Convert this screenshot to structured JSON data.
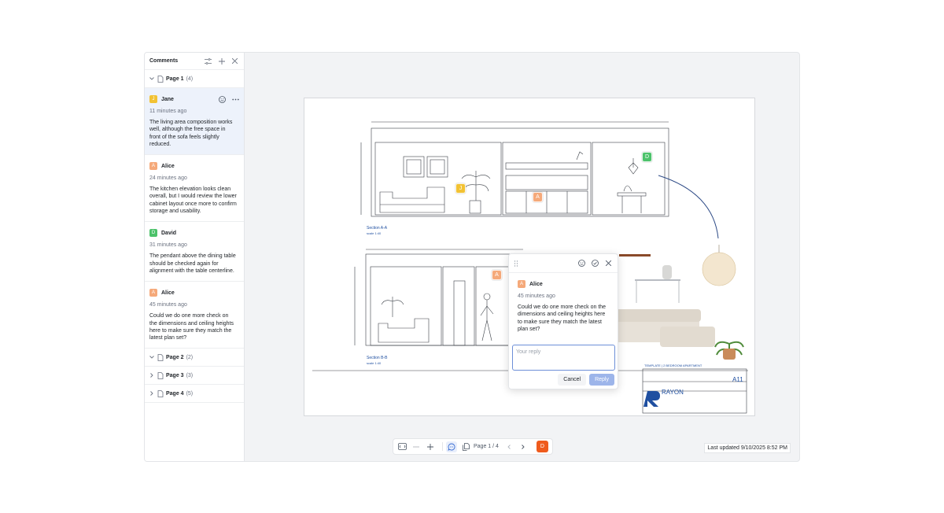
{
  "sidebar": {
    "title": "Comments",
    "pages": [
      {
        "name": "Page 1",
        "count": "(4)"
      },
      {
        "name": "Page 2",
        "count": "(2)"
      },
      {
        "name": "Page 3",
        "count": "(3)"
      },
      {
        "name": "Page 4",
        "count": "(5)"
      }
    ],
    "comments": [
      {
        "initial": "J",
        "author": "Jane",
        "time": "11 minutes ago",
        "text": "The living area composition works well, although the free space in front of the sofa feels slightly reduced.",
        "color": "#f2c233"
      },
      {
        "initial": "A",
        "author": "Alice",
        "time": "24 minutes ago",
        "text": "The kitchen elevation looks clean overall, but I would review the lower cabinet layout once more to confirm storage and usability.",
        "color": "#f5a97a"
      },
      {
        "initial": "D",
        "author": "David",
        "time": "31 minutes ago",
        "text": "The pendant above the dining table should be checked again for alignment with the table centerline.",
        "color": "#4cc26a"
      },
      {
        "initial": "A",
        "author": "Alice",
        "time": "45 minutes ago",
        "text": "Could we do one more check on the dimensions and ceiling heights here to make sure they match the latest plan set?",
        "color": "#f5a97a"
      }
    ]
  },
  "drawing": {
    "section_a": "Section A-A",
    "section_a_scale": "scale 1:40",
    "section_b": "Section B-B",
    "section_b_scale": "scale 1:40",
    "titleblock_template": "TEMPLATE | 2 BEDROOM APARTMENT",
    "titleblock_sheet": "A11",
    "brand": "RAYON"
  },
  "pins": [
    {
      "initial": "J",
      "color": "#f2c233"
    },
    {
      "initial": "A",
      "color": "#f5a97a"
    },
    {
      "initial": "D",
      "color": "#4cc26a"
    },
    {
      "initial": "A",
      "color": "#f5a97a"
    }
  ],
  "popover": {
    "initial": "A",
    "author": "Alice",
    "time": "45 minutes ago",
    "text": "Could we do one more check on the dimensions and ceiling heights here to make sure they match the latest plan set?",
    "reply_placeholder": "Your reply",
    "cancel_label": "Cancel",
    "reply_label": "Reply"
  },
  "toolbar": {
    "page_label": "Page 1 / 4",
    "user_initial": "D"
  },
  "status": {
    "last_updated": "Last updated 9/10/2025 8:52 PM"
  },
  "colors": {
    "accent": "#6d8fd8",
    "active_comment_bg": "#edf2fb",
    "user_badge": "#ef5b1d"
  }
}
